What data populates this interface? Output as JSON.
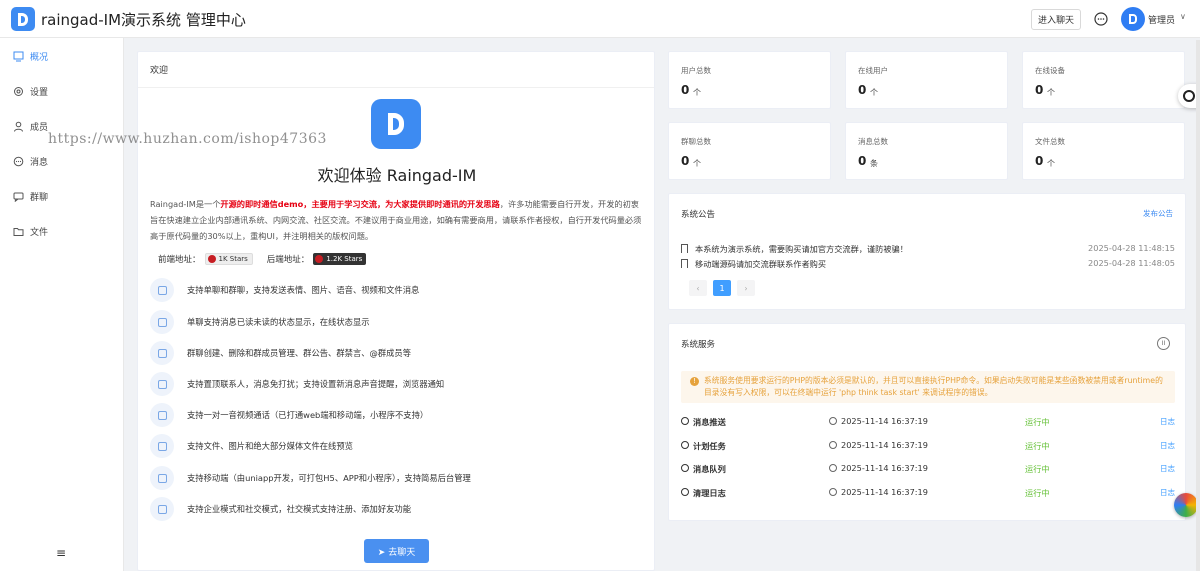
{
  "header": {
    "title": "raingad-IM演示系统 管理中心",
    "chat_button": "进入聊天",
    "user_name": "管理员",
    "caret": "∨"
  },
  "watermark": "https://www.huzhan.com/ishop47363",
  "sidebar": {
    "items": [
      {
        "label": "概况",
        "icon": "dashboard-icon",
        "active": true
      },
      {
        "label": "设置",
        "icon": "gear-icon"
      },
      {
        "label": "成员",
        "icon": "user-icon"
      },
      {
        "label": "消息",
        "icon": "message-icon"
      },
      {
        "label": "群聊",
        "icon": "group-icon"
      },
      {
        "label": "文件",
        "icon": "folder-icon"
      }
    ],
    "collapse": "≡"
  },
  "welcome": {
    "heading": "欢迎",
    "title": "欢迎体验 Raingad-IM",
    "intro_pre": "Raingad-IM是一个",
    "intro_red": "开源的即时通信demo，主要用于学习交流，为大家提供即时通讯的开发思路",
    "intro_post": "，许多功能需要自行开发，开发的初衷旨在快速建立企业内部通讯系统、内网交流、社区交流。不建议用于商业用途，如确有需要商用，请联系作者授权，自行开发代码量必须高于原代码量的30%以上，重构UI，并注明相关的版权问题。",
    "frontend_label": "前端地址：",
    "frontend_stars": "1K Stars",
    "backend_label": "后端地址：",
    "backend_stars": "1.2K Stars",
    "features": [
      "支持单聊和群聊，支持发送表情、图片、语音、视频和文件消息",
      "单聊支持消息已读未读的状态显示，在线状态显示",
      "群聊创建、删除和群成员管理、群公告、群禁言、@群成员等",
      "支持置顶联系人，消息免打扰；支持设置新消息声音提醒，浏览器通知",
      "支持一对一音视频通话（已打通web端和移动端，小程序不支持）",
      "支持文件、图片和绝大部分媒体文件在线预览",
      "支持移动端（由uniapp开发，可打包H5、APP和小程序），支持简易后台管理",
      "支持企业模式和社交模式，社交模式支持注册、添加好友功能"
    ],
    "go_button": "➤ 去聊天"
  },
  "stats": [
    {
      "label": "用户总数",
      "value": "0",
      "unit": "个"
    },
    {
      "label": "在线用户",
      "value": "0",
      "unit": "个"
    },
    {
      "label": "在线设备",
      "value": "0",
      "unit": "个"
    },
    {
      "label": "群聊总数",
      "value": "0",
      "unit": "个"
    },
    {
      "label": "消息总数",
      "value": "0",
      "unit": "条"
    },
    {
      "label": "文件总数",
      "value": "0",
      "unit": "个"
    }
  ],
  "notice": {
    "title": "系统公告",
    "publish": "发布公告",
    "items": [
      {
        "text": "本系统为演示系统，需要购买请加官方交流群，谨防被骗！",
        "time": "2025-04-28 11:48:15"
      },
      {
        "text": "移动端源码请加交流群联系作者购买",
        "time": "2025-04-28 11:48:05"
      }
    ],
    "prev": "‹",
    "page": "1",
    "next": "›"
  },
  "service": {
    "title": "系统服务",
    "pause": "II",
    "alert_icon": "!",
    "alert": "系统服务使用要求运行的PHP的版本必须是默认的，并且可以直接执行PHP命令。如果启动失败可能是某些函数被禁用或者runtime的目录没有写入权限，可以在终端中运行 'php think task start' 来调试程序的错误。",
    "rows": [
      {
        "name": "消息推送",
        "time": "2025-11-14 16:37:19",
        "status": "运行中",
        "log": "日志"
      },
      {
        "name": "计划任务",
        "time": "2025-11-14 16:37:19",
        "status": "运行中",
        "log": "日志"
      },
      {
        "name": "消息队列",
        "time": "2025-11-14 16:37:19",
        "status": "运行中",
        "log": "日志"
      },
      {
        "name": "清理日志",
        "time": "2025-11-14 16:37:19",
        "status": "运行中",
        "log": "日志"
      }
    ]
  },
  "colors": {
    "primary": "#3d8bf2",
    "success": "#67c23a",
    "warning": "#e6a23c",
    "danger": "#e60012"
  }
}
